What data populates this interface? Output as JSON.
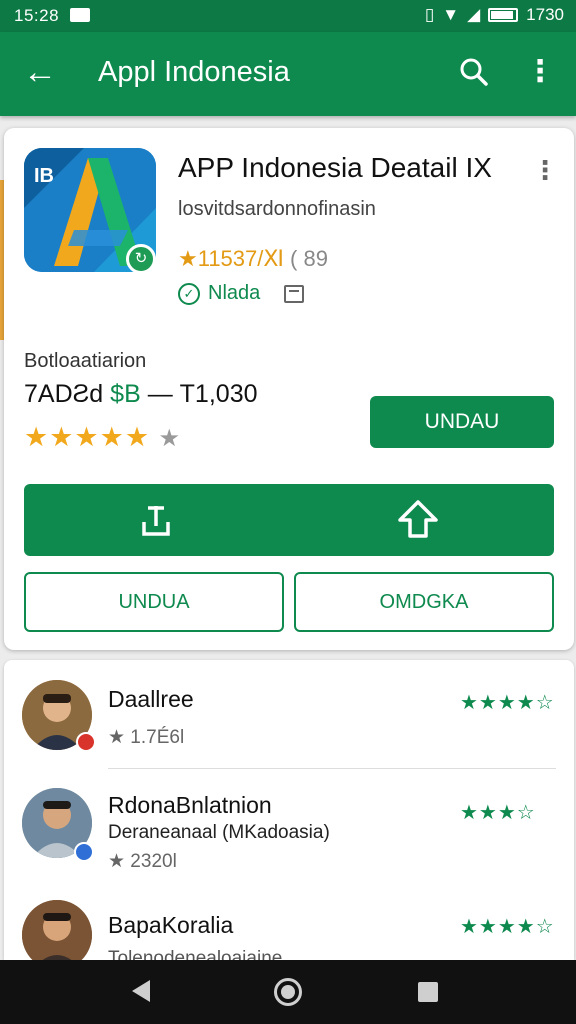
{
  "status_bar": {
    "time": "15:28",
    "right_text": "1730",
    "icons": [
      "notification-icon",
      "vibrate-icon",
      "wifi-icon",
      "signal-icon",
      "battery-icon"
    ]
  },
  "app_bar": {
    "title": "Appl Indonesia",
    "back_icon": "arrow-back-icon",
    "search_icon": "search-icon",
    "more_icon": "more-vert-icon"
  },
  "app": {
    "name": "APP Indonesia Deatail IX",
    "developer": "losvitdsardonnofinasin",
    "rating_text": "★11537/Ⅺ",
    "rating_count": "( 89",
    "verified_label": "Nlada",
    "icon_letter": "A",
    "icon_tag": "IB"
  },
  "details": {
    "section_label": "Botloaatiarion",
    "price_text": "7ADƧd",
    "price_accent": "$В",
    "price_range": "— T1,030",
    "stars_filled": "★★★★★",
    "stars_empty": "★",
    "install_label": "UNDAU"
  },
  "actions": {
    "share_icon": "share-icon",
    "upload_icon": "upload-icon",
    "left_button": "UNDUA",
    "right_button": "OMDGKA"
  },
  "reviews": [
    {
      "name": "Daallree",
      "sub": "",
      "meta": "★ 1.7É6l",
      "stars": "★★★★☆",
      "badge_color": "#d9342b"
    },
    {
      "name": "RdonaBnlatnion",
      "sub": "Deraneanaal (MKadoasia)",
      "meta": "★ 2320l",
      "stars": "★★★☆",
      "badge_color": "#2f6fd6"
    },
    {
      "name": "BapaKoralia",
      "sub": "Tolenodenealoaiaine",
      "meta": "",
      "stars": "★★★★☆",
      "badge_color": "#0e8a4e"
    }
  ],
  "colors": {
    "primary": "#0e8a4e",
    "status_bar": "#0d7a45",
    "star": "#f2a81c"
  }
}
